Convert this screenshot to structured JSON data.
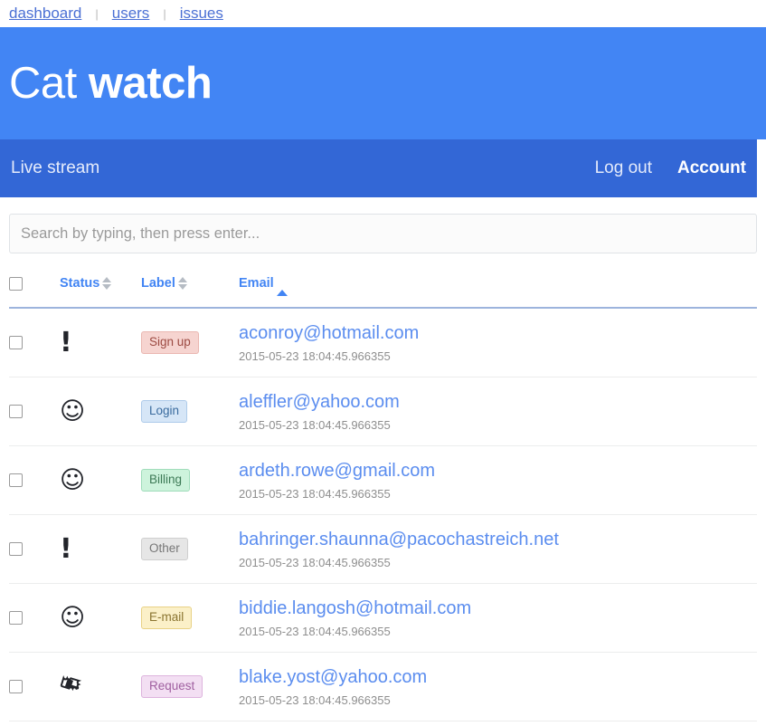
{
  "topnav": {
    "items": [
      {
        "label": "dashboard"
      },
      {
        "label": "users"
      },
      {
        "label": "issues"
      }
    ],
    "separator": "|"
  },
  "banner": {
    "brand_light": "Cat",
    "brand_bold": "watch",
    "background_color": "#4285f4"
  },
  "navbar": {
    "left_label": "Live stream",
    "logout_label": "Log out",
    "account_label": "Account",
    "background_color": "#3367d6"
  },
  "search": {
    "placeholder": "Search by typing, then press enter...",
    "value": ""
  },
  "table": {
    "columns": [
      {
        "key": "check",
        "label": ""
      },
      {
        "key": "status",
        "label": "Status",
        "sort": "none"
      },
      {
        "key": "label",
        "label": "Label",
        "sort": "none"
      },
      {
        "key": "email",
        "label": "Email",
        "sort": "asc"
      }
    ],
    "rows": [
      {
        "status_icon": "exclamation-icon",
        "status_glyph": "!",
        "label": "Sign up",
        "label_style": "signup",
        "email": "aconroy@hotmail.com",
        "timestamp": "2015-05-23 18:04:45.966355"
      },
      {
        "status_icon": "smiley-icon",
        "status_glyph": "☺",
        "label": "Login",
        "label_style": "login",
        "email": "aleffler@yahoo.com",
        "timestamp": "2015-05-23 18:04:45.966355"
      },
      {
        "status_icon": "smiley-icon",
        "status_glyph": "☺",
        "label": "Billing",
        "label_style": "billing",
        "email": "ardeth.rowe@gmail.com",
        "timestamp": "2015-05-23 18:04:45.966355"
      },
      {
        "status_icon": "exclamation-icon",
        "status_glyph": "!",
        "label": "Other",
        "label_style": "other",
        "email": "bahringer.shaunna@pacochastreich.net",
        "timestamp": "2015-05-23 18:04:45.966355"
      },
      {
        "status_icon": "smiley-icon",
        "status_glyph": "☺",
        "label": "E-mail",
        "label_style": "email",
        "email": "biddie.langosh@hotmail.com",
        "timestamp": "2015-05-23 18:04:45.966355"
      },
      {
        "status_icon": "ticket-icon",
        "status_glyph": "🎫",
        "label": "Request",
        "label_style": "request",
        "email": "blake.yost@yahoo.com",
        "timestamp": "2015-05-23 18:04:45.966355"
      }
    ]
  }
}
